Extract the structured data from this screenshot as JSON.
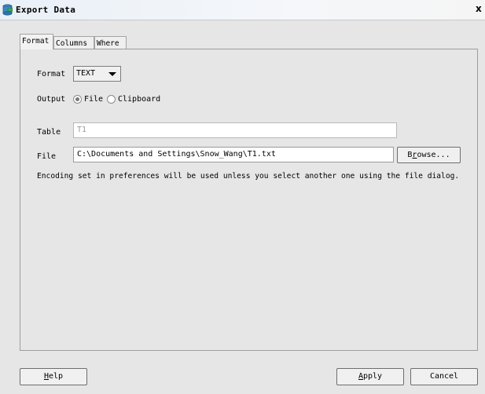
{
  "window": {
    "title": "Export Data",
    "close_glyph": "x",
    "title_icon": "export-data-icon"
  },
  "tabs": [
    {
      "label": "Format",
      "active": true
    },
    {
      "label": "Columns",
      "active": false
    },
    {
      "label": "Where",
      "active": false
    }
  ],
  "format": {
    "label": "Format",
    "selected": "TEXT"
  },
  "output": {
    "label": "Output",
    "options": [
      {
        "label": "File",
        "selected": true
      },
      {
        "label": "Clipboard",
        "selected": false
      }
    ]
  },
  "table": {
    "label": "Table",
    "value": "T1"
  },
  "file": {
    "label": "File",
    "value": "C:\\Documents and Settings\\Snow_Wang\\T1.txt",
    "browse_label_pre": "B",
    "browse_label_mnemonic": "r",
    "browse_label_post": "owse..."
  },
  "encoding_note": "Encoding set in preferences will be used unless you select another one using the file dialog.",
  "buttons": {
    "help_mnemonic": "H",
    "help_rest": "elp",
    "apply_mnemonic": "A",
    "apply_rest": "pply",
    "cancel": "Cancel"
  },
  "colors": {
    "dialog_bg": "#e6e6e6",
    "title_bg": "#eef3f8"
  }
}
